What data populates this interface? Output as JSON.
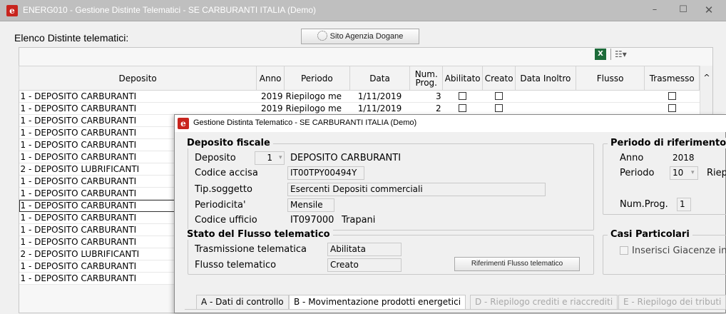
{
  "window": {
    "title": "ENERG010 - Gestione Distinte Telematici  - SE  CARBURANTI ITALIA  (Demo)",
    "icon": "app-logo-icon",
    "min": "–",
    "max": "☐",
    "close": "✕"
  },
  "list": {
    "caption": "Elenco Distinte telematici:",
    "sito_button": "Sito Agenzia Dogane",
    "columns": [
      "Deposito",
      "Anno",
      "Periodo",
      "Data",
      "Num.\nProg.",
      "Abilitato",
      "Creato",
      "Data Inoltro",
      "Flusso",
      "Trasmesso"
    ],
    "rows": [
      {
        "deposito": "1 - DEPOSITO CARBURANTI",
        "anno": "2019",
        "periodo": "Riepilogo me",
        "data": "1/11/2019",
        "num": "3"
      },
      {
        "deposito": "1 - DEPOSITO CARBURANTI",
        "anno": "2019",
        "periodo": "Riepilogo me",
        "data": "1/11/2019",
        "num": "2"
      },
      {
        "deposito": "1 - DEPOSITO CARBURANTI"
      },
      {
        "deposito": "1 - DEPOSITO CARBURANTI"
      },
      {
        "deposito": "1 - DEPOSITO CARBURANTI"
      },
      {
        "deposito": "1 - DEPOSITO CARBURANTI"
      },
      {
        "deposito": "2 - DEPOSITO LUBRIFICANTI"
      },
      {
        "deposito": "1 - DEPOSITO CARBURANTI"
      },
      {
        "deposito": "1 - DEPOSITO CARBURANTI"
      },
      {
        "deposito": "1 - DEPOSITO CARBURANTI",
        "selected": true
      },
      {
        "deposito": "1 - DEPOSITO CARBURANTI"
      },
      {
        "deposito": "1 - DEPOSITO CARBURANTI"
      },
      {
        "deposito": "1 - DEPOSITO CARBURANTI"
      },
      {
        "deposito": "2 - DEPOSITO LUBRIFICANTI"
      },
      {
        "deposito": "1 - DEPOSITO CARBURANTI"
      },
      {
        "deposito": "1 - DEPOSITO CARBURANTI"
      }
    ]
  },
  "dialog": {
    "title": "Gestione Distinta Telematico - SE  CARBURANTI ITALIA  (Demo)",
    "deposito_fiscale": {
      "title": "Deposito fiscale",
      "deposito_label": "Deposito",
      "deposito_code": "1",
      "deposito_name": "DEPOSITO CARBURANTI",
      "codice_accisa_label": "Codice accisa",
      "codice_accisa": "IT00TPY00494Y",
      "tip_soggetto_label": "Tip.soggetto",
      "tip_soggetto": "Esercenti Depositi commerciali",
      "periodicita_label": "Periodicita'",
      "periodicita": "Mensile",
      "codice_ufficio_label": "Codice ufficio",
      "codice_ufficio": "IT097000",
      "ufficio_nome": "Trapani"
    },
    "periodo": {
      "title": "Periodo di riferimento",
      "anno_label": "Anno",
      "anno": "2018",
      "periodo_label": "Periodo",
      "periodo": "10",
      "periodo_desc": "Riep",
      "numprog_label": "Num.Prog.",
      "numprog": "1"
    },
    "stato": {
      "title": "Stato del Flusso telematico",
      "trasmissione_label": "Trasmissione telematica",
      "trasmissione": "Abilitata",
      "flusso_label": "Flusso telematico",
      "flusso": "Creato",
      "riferimenti_button": "Riferimenti Flusso telematico"
    },
    "casi": {
      "title": "Casi Particolari",
      "inserisci_giacenze": "Inserisci Giacenze ini"
    },
    "tabs": [
      {
        "label": "A - Dati di controllo",
        "enabled": true
      },
      {
        "label": "B - Movimentazione prodotti energetici",
        "enabled": true
      },
      {
        "label": "D - Riepilogo crediti e riaccrediti",
        "enabled": false
      },
      {
        "label": "E - Riepilogo dei tributi",
        "enabled": false
      }
    ]
  }
}
